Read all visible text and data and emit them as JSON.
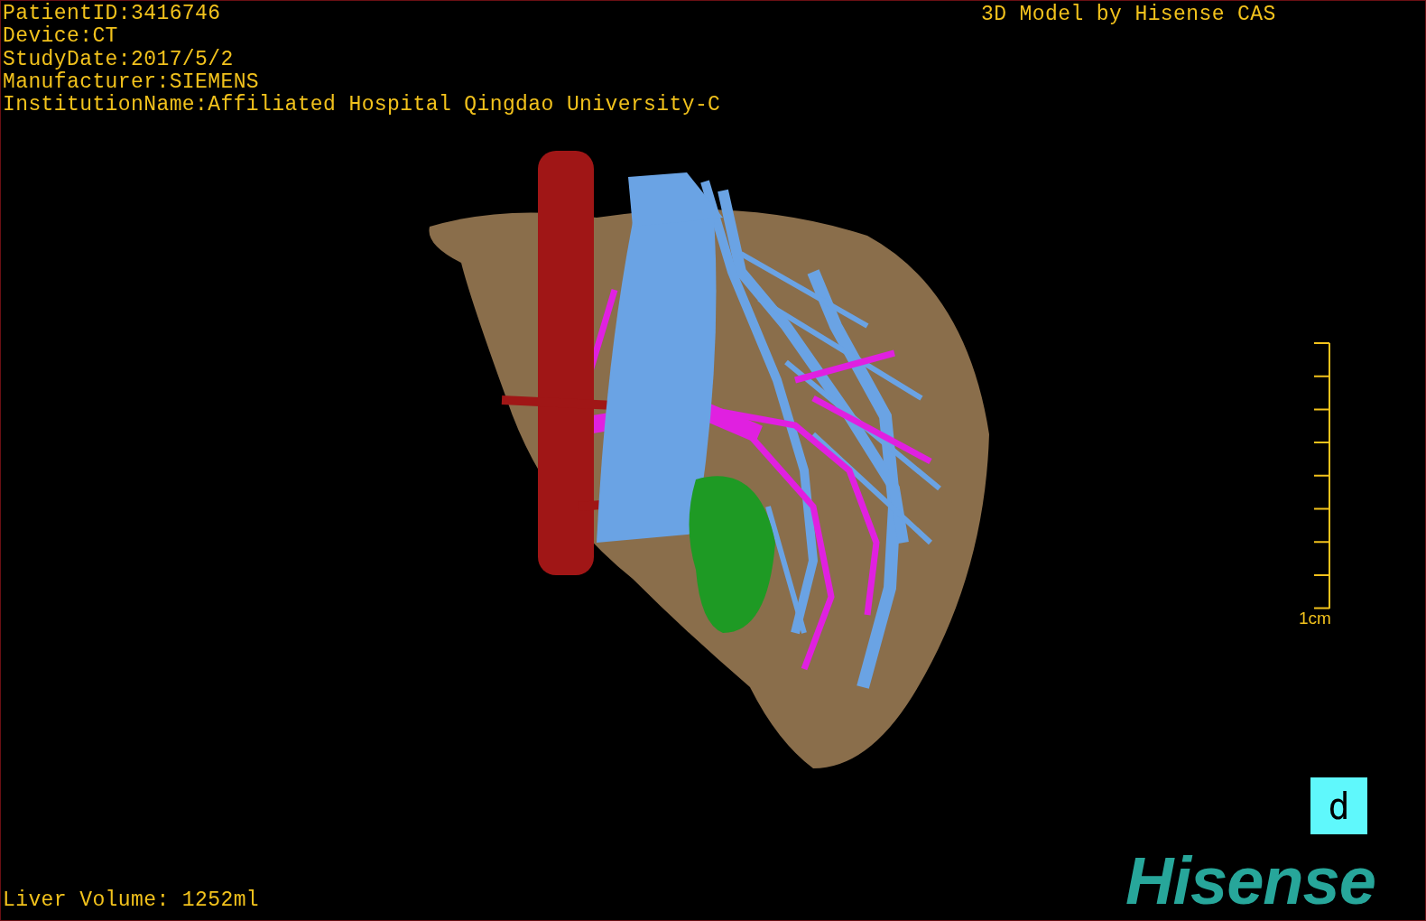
{
  "patient_info": [
    "PatientID:3416746",
    "Device:CT",
    "StudyDate:2017/5/2",
    "Manufacturer:SIEMENS",
    "InstitutionName:Affiliated Hospital Qingdao University-C"
  ],
  "header_title": "3D Model by Hisense CAS",
  "scale_bar": {
    "label": "1cm"
  },
  "view_label": "d",
  "liver_volume": "Liver Volume: 1252ml",
  "logo": "Hisense"
}
